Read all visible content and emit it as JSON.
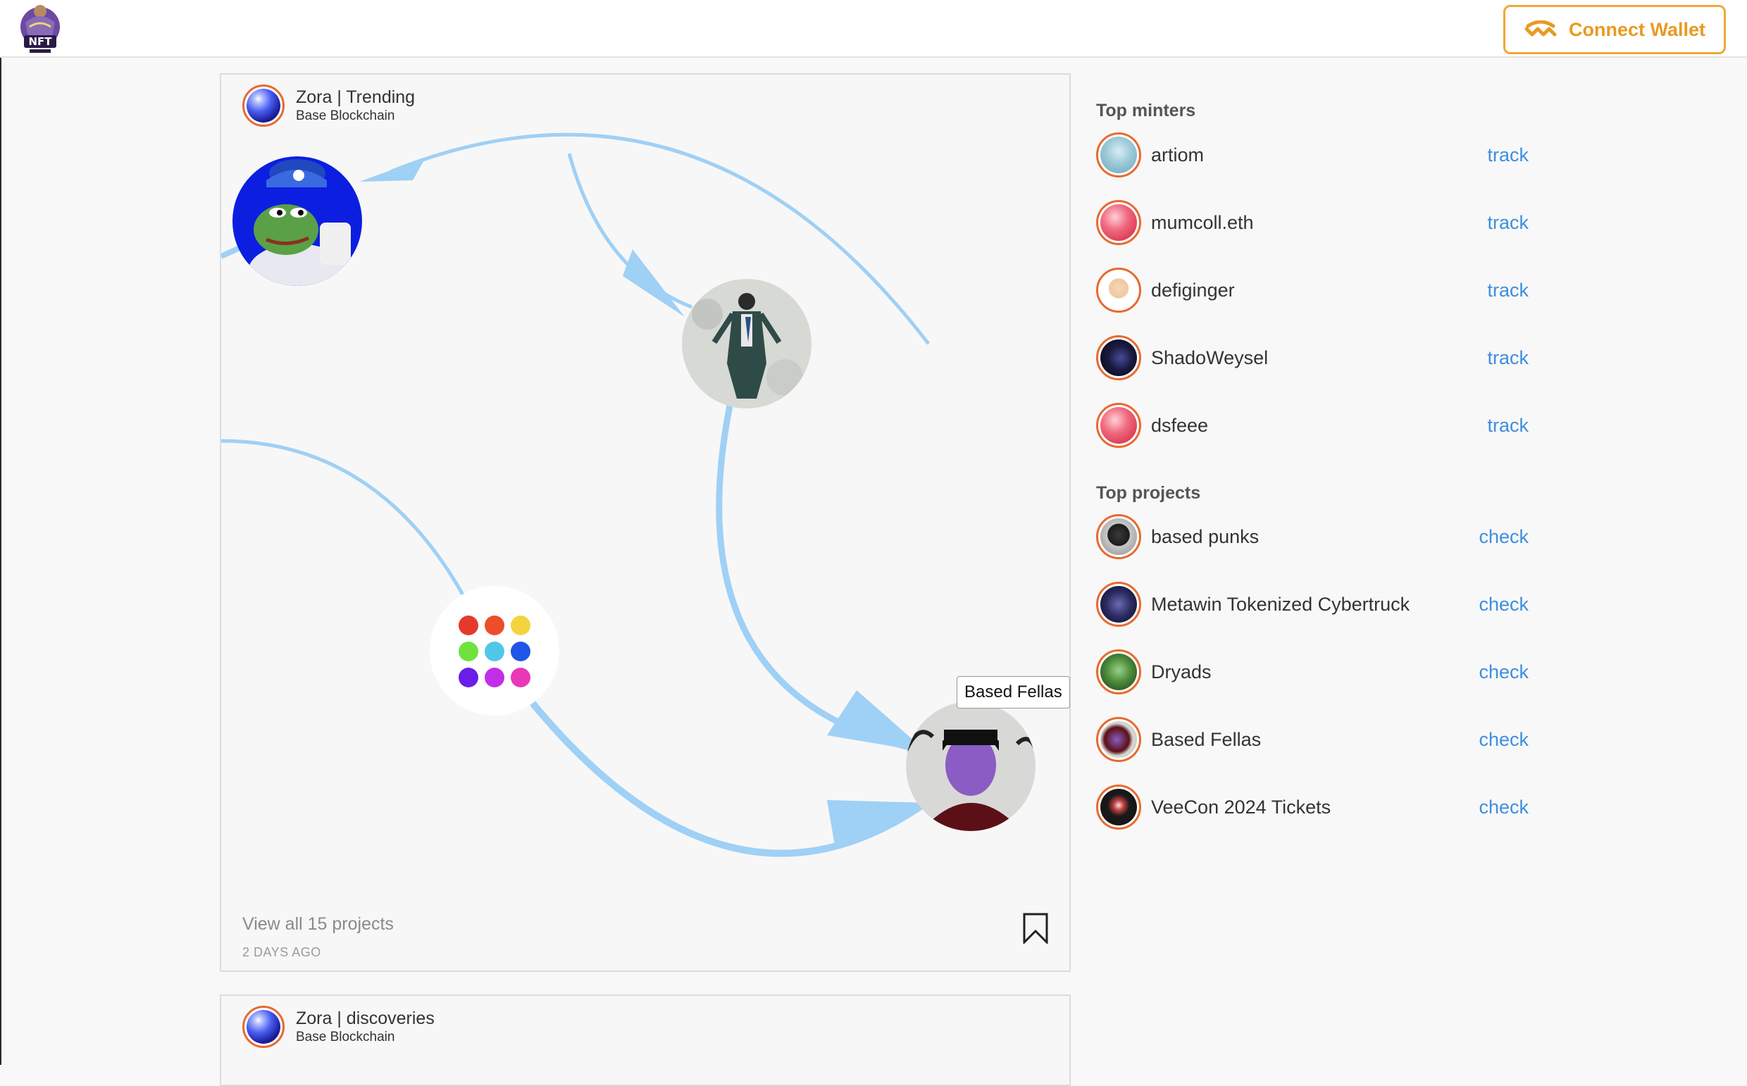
{
  "header": {
    "logo_text": "NFT",
    "connect_label": "Connect Wallet",
    "connect_icon": "walletconnect-icon",
    "accent_color": "#f0a737"
  },
  "feed": [
    {
      "title": "Zora | Trending",
      "subtitle": "Base Blockchain",
      "tooltip": "Based Fellas",
      "view_all": "View all 15 projects",
      "posted": "2 DAYS AGO"
    },
    {
      "title": "Zora | discoveries",
      "subtitle": "Base Blockchain"
    }
  ],
  "sidebar": {
    "minters_heading": "Top minters",
    "minters": [
      {
        "name": "artiom",
        "action": "track"
      },
      {
        "name": "mumcoll.eth",
        "action": "track"
      },
      {
        "name": "defiginger",
        "action": "track"
      },
      {
        "name": "ShadoWeysel",
        "action": "track"
      },
      {
        "name": "dsfeee",
        "action": "track"
      }
    ],
    "projects_heading": "Top projects",
    "projects": [
      {
        "name": "based punks",
        "action": "check"
      },
      {
        "name": "Metawin Tokenized Cybertruck",
        "action": "check"
      },
      {
        "name": "Dryads",
        "action": "check"
      },
      {
        "name": "Based Fellas",
        "action": "check"
      },
      {
        "name": "VeeCon 2024 Tickets",
        "action": "check"
      }
    ]
  },
  "colors": {
    "edge": "#9fd0f5",
    "link": "#3d8ee0",
    "ring": "#e8692e"
  }
}
